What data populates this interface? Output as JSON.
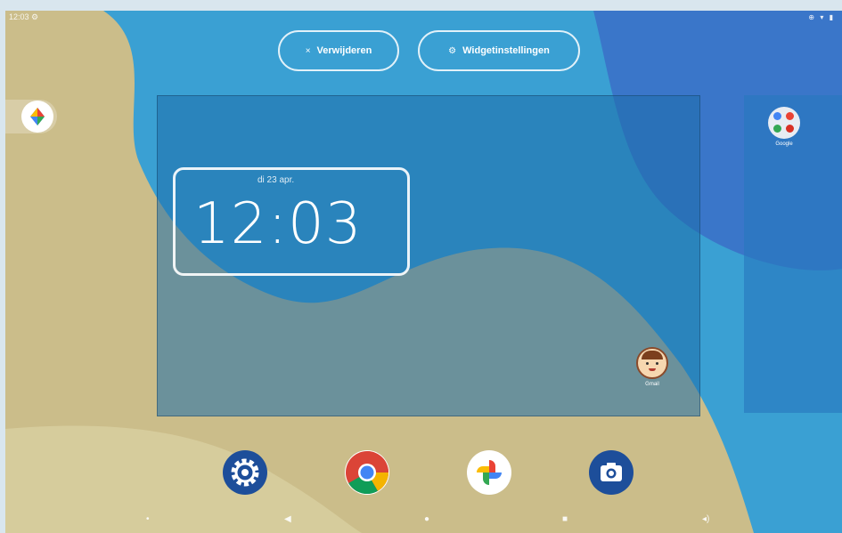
{
  "status_bar": {
    "time": "12:03 ⚙",
    "icons": "⊕ ▾ ▮"
  },
  "top_actions": {
    "remove": {
      "icon": "×",
      "label": "Verwijderen"
    },
    "widget_settings": {
      "icon": "⚙",
      "label": "Widgetinstellingen"
    }
  },
  "clock_widget": {
    "date": "di 23 apr.",
    "time": "12:03"
  },
  "apps": {
    "google_folder_label": "Google",
    "avatar_app_label": "Gmail"
  },
  "dock": {
    "items": [
      "settings-icon",
      "chrome-icon",
      "photos-icon",
      "camera-icon"
    ]
  },
  "colors": {
    "wallpaper_blue": "#3aa0d3",
    "wallpaper_dark_blue": "#3a76c9",
    "wallpaper_sand": "#cbbd8a",
    "dock_icon_blue": "#1d4e9a"
  }
}
